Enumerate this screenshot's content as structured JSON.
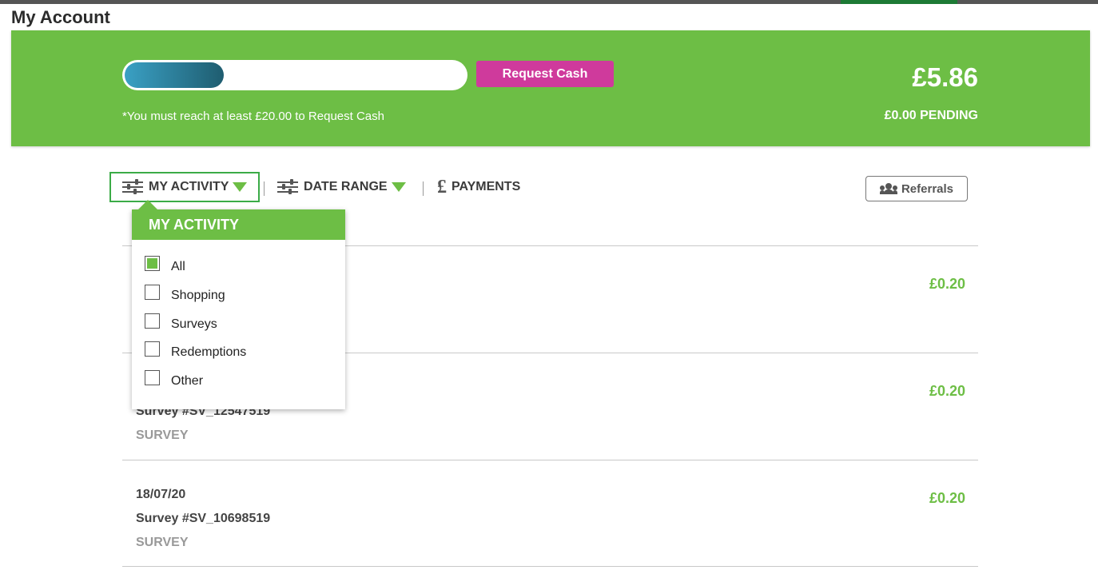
{
  "page": {
    "title": "My Account"
  },
  "balance_banner": {
    "progress_fraction": 0.29,
    "request_cash_label": "Request Cash",
    "minimum_note": "*You must reach at least £20.00 to Request Cash",
    "balance": "£5.86",
    "pending": "£0.00 PENDING",
    "colors": {
      "banner": "#6dbe45",
      "request_button": "#cf3a9c"
    }
  },
  "filters": {
    "my_activity_label": "MY ACTIVITY",
    "date_range_label": "DATE RANGE",
    "payments_label": "PAYMENTS",
    "referrals_label": "Referrals"
  },
  "activity_dropdown": {
    "header": "MY ACTIVITY",
    "options": [
      {
        "label": "All",
        "checked": true
      },
      {
        "label": "Shopping",
        "checked": false
      },
      {
        "label": "Surveys",
        "checked": false
      },
      {
        "label": "Redemptions",
        "checked": false
      },
      {
        "label": "Other",
        "checked": false
      }
    ]
  },
  "activity_rows": [
    {
      "date": "",
      "title": "",
      "type": "",
      "amount": "£0.20"
    },
    {
      "date": "",
      "title": "Survey #SV_12547519",
      "type": "SURVEY",
      "amount": "£0.20"
    },
    {
      "date": "18/07/20",
      "title": "Survey #SV_10698519",
      "type": "SURVEY",
      "amount": "£0.20"
    }
  ]
}
